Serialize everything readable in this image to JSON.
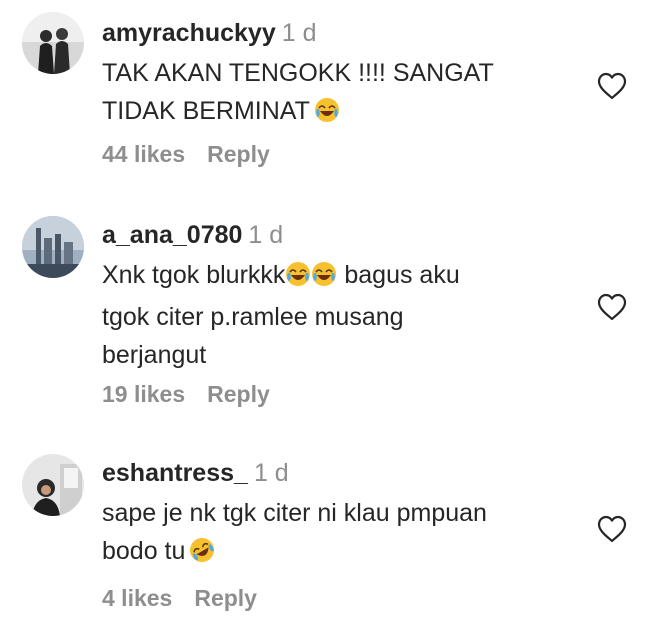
{
  "comments": [
    {
      "username": "amyrachuckyy",
      "time": "1 d",
      "text_line1": "TAK AKAN TENGOKK !!!! SANGAT",
      "text_line2": "TIDAK BERMINAT",
      "likes": "44 likes",
      "reply": "Reply"
    },
    {
      "username": "a_ana_0780",
      "time": "1 d",
      "text_line1": "Xnk tgok blurkkk",
      "text_line1b": " bagus aku",
      "text_line2": "tgok citer p.ramlee musang",
      "text_line3": "berjangut",
      "likes": "19 likes",
      "reply": "Reply"
    },
    {
      "username": "eshantress_",
      "time": "1 d",
      "text_line1": "sape je nk tgk citer ni klau pmpuan",
      "text_line2": "bodo tu",
      "likes": "4 likes",
      "reply": "Reply"
    }
  ],
  "icons": {
    "emoji_joy": "face-with-tears-of-joy",
    "emoji_rofl": "rolling-on-floor-laughing",
    "like": "heart-outline"
  },
  "colors": {
    "text": "#262626",
    "secondary": "#8e8e8e",
    "emoji_face": "#f7c02e"
  }
}
